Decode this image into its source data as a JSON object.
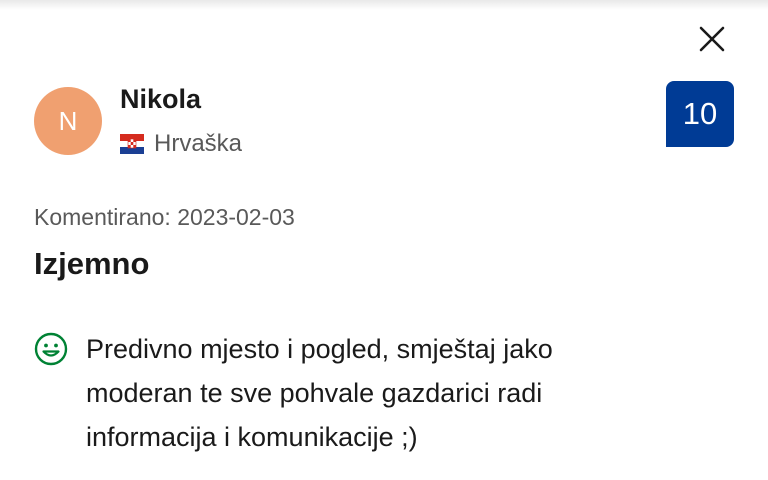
{
  "close_icon": "close-icon",
  "reviewer": {
    "initial": "N",
    "name": "Nikola",
    "country": "Hrvaška",
    "flag_icon": "croatia-flag-icon",
    "avatar_color": "#f0a070"
  },
  "score": {
    "value": "10",
    "bg_color": "#003b95"
  },
  "review": {
    "date_text": "Komentirano: 2023-02-03",
    "title": "Izjemno",
    "positive_icon": "smiley-positive-icon",
    "positive_color": "#008234",
    "positive_text": "Predivno mjesto i pogled, smještaj jako moderan te sve pohvale gazdarici radi informacija i komunikacije ;)"
  }
}
